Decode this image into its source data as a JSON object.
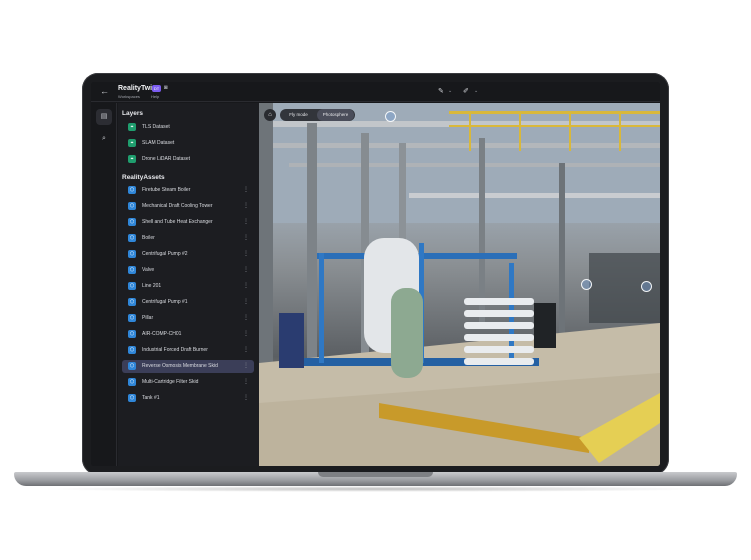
{
  "app": {
    "title": "RealityTwin",
    "badge": "DT",
    "nav": {
      "workspaces": "Workspaces",
      "help": "Help"
    },
    "back_icon": "arrow-left-icon",
    "camera_icon": "camera-icon"
  },
  "toolbar": {
    "tool_a_icon": "paint-palette-icon",
    "tool_b_icon": "pencil-icon",
    "caret_icon": "chevron-down-icon"
  },
  "rail": [
    {
      "name": "layers-icon",
      "glyph": "⧉"
    },
    {
      "name": "search-icon",
      "glyph": "⌕"
    }
  ],
  "sidebar": {
    "layers_title": "Layers",
    "layers": [
      {
        "label": "TLS Dataset"
      },
      {
        "label": "SLAM Dataset"
      },
      {
        "label": "Drone LiDAR Dataset"
      }
    ],
    "assets_title": "RealityAssets",
    "assets": [
      {
        "label": "Firetube Steam Boiler",
        "selected": false
      },
      {
        "label": "Mechanical Draft Cooling Tower",
        "selected": false
      },
      {
        "label": "Shell and Tube Heat Exchanger",
        "selected": false
      },
      {
        "label": "Boiler",
        "selected": false
      },
      {
        "label": "Centrifugal Pump #2",
        "selected": false
      },
      {
        "label": "Valve",
        "selected": false
      },
      {
        "label": "Line 201",
        "selected": false
      },
      {
        "label": "Centrifugal Pump #1",
        "selected": false
      },
      {
        "label": "Pillar",
        "selected": false
      },
      {
        "label": "AIR-COMP-CH01",
        "selected": false
      },
      {
        "label": "Industrial Forced Draft Burner",
        "selected": false
      },
      {
        "label": "Reverse Osmosis Membrane Skid",
        "selected": true
      },
      {
        "label": "Multi-Cartridge Filter Skid",
        "selected": false
      },
      {
        "label": "Tank #1",
        "selected": false
      }
    ]
  },
  "viewport": {
    "modes": {
      "fly": "Fly mode",
      "photo": "Photosphere"
    },
    "active_mode": "Photosphere",
    "home_icon": "home-icon"
  },
  "colors": {
    "accent": "#7b5cf0",
    "selected_row": "#3b3e58",
    "dataset_icon": "#1f9e6e",
    "asset_icon": "#2f86d8"
  }
}
